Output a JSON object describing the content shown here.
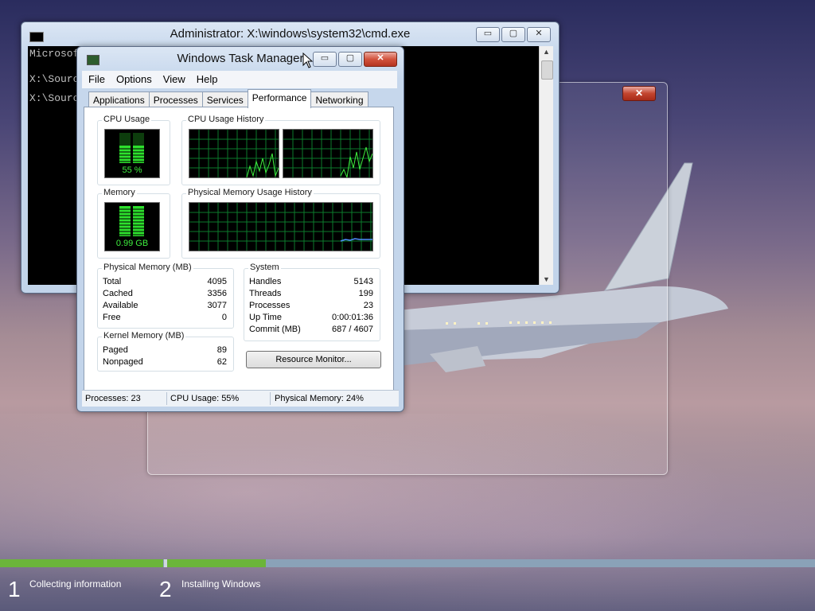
{
  "cmd": {
    "title": "Administrator: X:\\windows\\system32\\cmd.exe",
    "lines": [
      "Microsof",
      "X:\\Sourc",
      "X:\\Sourc"
    ],
    "btn_min": "▭",
    "btn_max": "▢",
    "btn_close": "✕"
  },
  "taskmgr": {
    "title": "Windows Task Manager",
    "menu": [
      "File",
      "Options",
      "View",
      "Help"
    ],
    "tabs": [
      "Applications",
      "Processes",
      "Services",
      "Performance",
      "Networking"
    ],
    "active_tab": "Performance",
    "cpu_usage_label": "CPU Usage",
    "cpu_usage_value": "55 %",
    "cpu_history_label": "CPU Usage History",
    "memory_label": "Memory",
    "memory_value": "0.99 GB",
    "phys_history_label": "Physical Memory Usage History",
    "physical_memory": {
      "label": "Physical Memory (MB)",
      "rows": [
        {
          "k": "Total",
          "v": "4095"
        },
        {
          "k": "Cached",
          "v": "3356"
        },
        {
          "k": "Available",
          "v": "3077"
        },
        {
          "k": "Free",
          "v": "0"
        }
      ]
    },
    "kernel_memory": {
      "label": "Kernel Memory (MB)",
      "rows": [
        {
          "k": "Paged",
          "v": "89"
        },
        {
          "k": "Nonpaged",
          "v": "62"
        }
      ]
    },
    "system": {
      "label": "System",
      "rows": [
        {
          "k": "Handles",
          "v": "5143"
        },
        {
          "k": "Threads",
          "v": "199"
        },
        {
          "k": "Processes",
          "v": "23"
        },
        {
          "k": "Up Time",
          "v": "0:00:01:36"
        },
        {
          "k": "Commit (MB)",
          "v": "687 / 4607"
        }
      ]
    },
    "resource_monitor_button": "Resource Monitor...",
    "status": {
      "processes": "Processes: 23",
      "cpu": "CPU Usage: 55%",
      "memory": "Physical Memory: 24%"
    }
  },
  "glass_close": "✕",
  "setup": {
    "progress_fraction": 0.33,
    "steps": [
      {
        "num": "1",
        "label": "Collecting information"
      },
      {
        "num": "2",
        "label": "Installing Windows"
      }
    ]
  },
  "colors": {
    "meter_green": "#3ff03f",
    "grid_green": "#0c7a2c",
    "progress_green": "#6bb53a"
  }
}
